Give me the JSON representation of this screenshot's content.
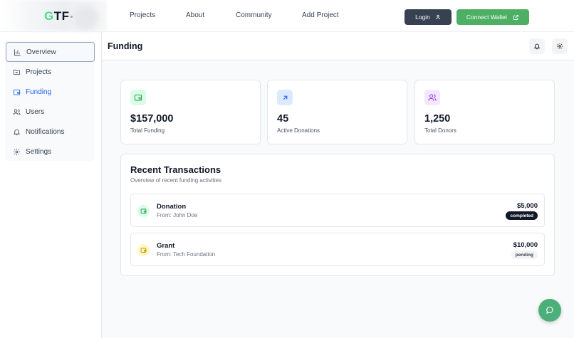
{
  "brand": {
    "logo_text": "GTF"
  },
  "nav": {
    "links": [
      "Projects",
      "About",
      "Community",
      "Add Project"
    ],
    "login_label": "Login",
    "wallet_label": "Connect Wallet"
  },
  "sidebar": {
    "items": [
      {
        "label": "Overview",
        "icon": "bar-chart-icon"
      },
      {
        "label": "Projects",
        "icon": "folder-icon"
      },
      {
        "label": "Funding",
        "icon": "wallet-icon"
      },
      {
        "label": "Users",
        "icon": "users-icon"
      },
      {
        "label": "Notifications",
        "icon": "bell-icon"
      },
      {
        "label": "Settings",
        "icon": "gear-icon"
      }
    ]
  },
  "header": {
    "title": "Funding"
  },
  "stats": [
    {
      "value": "$157,000",
      "label": "Total Funding",
      "icon": "wallet-icon",
      "color": "#16a34a"
    },
    {
      "value": "45",
      "label": "Active Donations",
      "icon": "arrow-up-right-icon",
      "color": "#2563eb"
    },
    {
      "value": "1,250",
      "label": "Total Donors",
      "icon": "users-icon",
      "color": "#9333ea"
    }
  ],
  "transactions": {
    "title": "Recent Transactions",
    "subtitle": "Overview of recent funding activities",
    "rows": [
      {
        "name": "Donation",
        "from": "From: John Doe",
        "amount": "$5,000",
        "status": "completed"
      },
      {
        "name": "Grant",
        "from": "From: Tech Foundation",
        "amount": "$10,000",
        "status": "pending"
      }
    ]
  },
  "colors": {
    "accent_green": "#4caf63",
    "primary_dark": "#374151",
    "funding_blue": "#2563eb"
  }
}
